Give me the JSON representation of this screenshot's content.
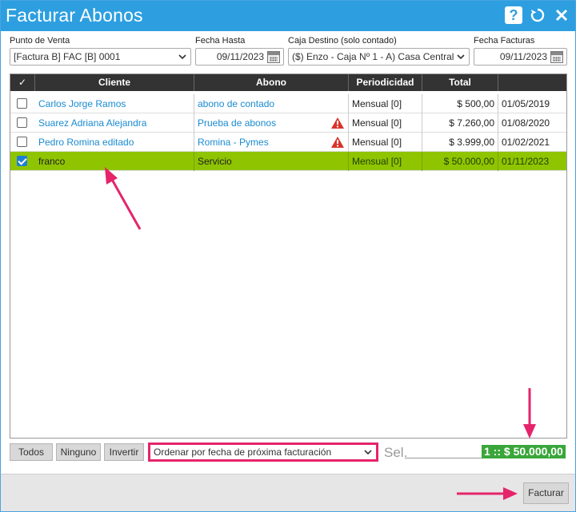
{
  "window": {
    "title": "Facturar Abonos"
  },
  "titlebar": {
    "help_icon": "question-icon",
    "refresh_icon": "refresh-icon",
    "close_icon": "close-icon"
  },
  "form": {
    "punto_venta": {
      "label": "Punto de Venta",
      "value": "[Factura B] FAC [B] 0001"
    },
    "fecha_hasta": {
      "label": "Fecha Hasta",
      "value": "09/11/2023"
    },
    "caja_destino": {
      "label": "Caja Destino (solo contado)",
      "value": "($) Enzo - Caja Nº 1 - A) Casa Central"
    },
    "fecha_facturas": {
      "label": "Fecha Facturas",
      "value": "09/11/2023"
    }
  },
  "table": {
    "headers": {
      "check": "✓",
      "cliente": "Cliente",
      "abono": "Abono",
      "periodicidad": "Periodicidad",
      "total": "Total",
      "fecha": ""
    },
    "rows": [
      {
        "cliente": "Carlos Jorge Ramos",
        "abono": "abono de contado",
        "warning": false,
        "periodicidad": "Mensual [0]",
        "total": "$ 500,00",
        "fecha": "01/05/2019",
        "checked": false
      },
      {
        "cliente": "Suarez Adriana Alejandra",
        "abono": "Prueba de abonos",
        "warning": true,
        "periodicidad": "Mensual [0]",
        "total": "$ 7.260,00",
        "fecha": "01/08/2020",
        "checked": false
      },
      {
        "cliente": "Pedro Romina editado",
        "abono": "Romina - Pymes",
        "warning": true,
        "periodicidad": "Mensual [0]",
        "total": "$ 3.999,00",
        "fecha": "01/02/2021",
        "checked": false
      },
      {
        "cliente": "franco",
        "abono": "Servicio",
        "warning": false,
        "periodicidad": "Mensual [0]",
        "total": "$ 50.000,00",
        "fecha": "01/11/2023",
        "checked": true
      }
    ]
  },
  "bottom": {
    "todos": "Todos",
    "ninguno": "Ninguno",
    "invertir": "Invertir",
    "order_select": "Ordenar por fecha de próxima facturación",
    "sel_label": "Sel.",
    "total_badge": "1 :: $ 50.000,00"
  },
  "footer": {
    "facturar": "Facturar"
  },
  "colors": {
    "titlebar": "#2d9fe0",
    "selected_row": "#8fc400",
    "link": "#1a8bd0",
    "annotation": "#e5246b",
    "badge": "#3aa63a"
  }
}
